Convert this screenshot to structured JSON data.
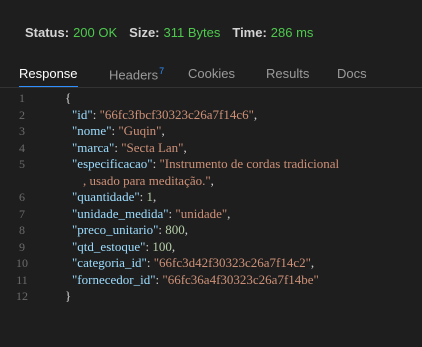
{
  "status": {
    "status_label": "Status:",
    "status_value": "200 OK",
    "size_label": "Size:",
    "size_value": "311 Bytes",
    "time_label": "Time:",
    "time_value": "286 ms"
  },
  "tabs": [
    {
      "label": "Response",
      "active": true
    },
    {
      "label": "Headers",
      "badge": "7",
      "active": false
    },
    {
      "label": "Cookies",
      "active": false
    },
    {
      "label": "Results",
      "active": false
    },
    {
      "label": "Docs",
      "active": false
    }
  ],
  "code": {
    "lines": [
      {
        "n": "1",
        "open": "{"
      },
      {
        "n": "2",
        "key": "\"id\"",
        "value": "\"66fc3fbcf30323c26a7f14c6\"",
        "type": "string"
      },
      {
        "n": "3",
        "key": "\"nome\"",
        "value": "\"Guqin\"",
        "type": "string"
      },
      {
        "n": "4",
        "key": "\"marca\"",
        "value": "\"Secta Lan\"",
        "type": "string"
      },
      {
        "n": "5",
        "key": "\"especificacao\"",
        "value": "\"Instrumento de cordas tradicional",
        "value_cont": ", usado para meditação.\"",
        "type": "string"
      },
      {
        "n": "6",
        "key": "\"quantidade\"",
        "value": "1",
        "type": "number"
      },
      {
        "n": "7",
        "key": "\"unidade_medida\"",
        "value": "\"unidade\"",
        "type": "string"
      },
      {
        "n": "8",
        "key": "\"preco_unitario\"",
        "value": "800",
        "type": "number"
      },
      {
        "n": "9",
        "key": "\"qtd_estoque\"",
        "value": "100",
        "type": "number"
      },
      {
        "n": "10",
        "key": "\"categoria_id\"",
        "value": "\"66fc3d42f30323c26a7f14c2\"",
        "type": "string"
      },
      {
        "n": "11",
        "key": "\"fornecedor_id\"",
        "value": "\"66fc36a4f30323c26a7f14be\"",
        "type": "string"
      },
      {
        "n": "12",
        "close": "}"
      }
    ]
  },
  "colors": {
    "background": "#1e1e1e",
    "status_green": "#4ec94e",
    "active_tab_underline": "#2f8fff",
    "json_key": "#9cdcfe",
    "json_string": "#ce9178",
    "json_number": "#b5cea8",
    "line_number": "#6b6b6b"
  }
}
